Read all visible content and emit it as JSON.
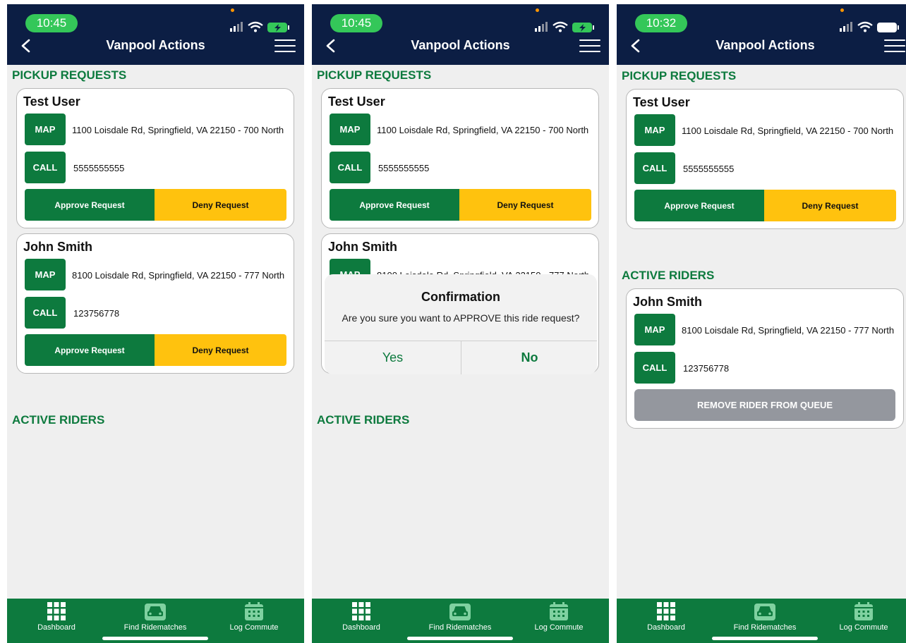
{
  "colors": {
    "navy": "#0c1e44",
    "green": "#0d7a3e",
    "yellow": "#ffc20e",
    "gray": "#94979e",
    "background": "#efefef"
  },
  "header": {
    "title": "Vanpool Actions"
  },
  "sections": {
    "pickup": "PICKUP REQUESTS",
    "active": "ACTIVE RIDERS"
  },
  "buttons": {
    "map": "MAP",
    "call": "CALL",
    "approve": "Approve Request",
    "deny": "Deny Request",
    "remove": "REMOVE RIDER FROM QUEUE"
  },
  "screens": [
    {
      "time": "10:45"
    },
    {
      "time": "10:45"
    },
    {
      "time": "10:32"
    }
  ],
  "riders": {
    "test_user": {
      "name": "Test User",
      "address": "1100 Loisdale Rd, Springfield, VA 22150 - 700 North",
      "phone": "5555555555"
    },
    "john_smith": {
      "name": "John Smith",
      "address": "8100 Loisdale Rd, Springfield, VA 22150 - 777 North",
      "phone": "123756778"
    }
  },
  "dialog": {
    "title": "Confirmation",
    "message": "Are you sure you want to APPROVE this ride request?",
    "yes": "Yes",
    "no": "No"
  },
  "tabs": [
    {
      "label": "Dashboard",
      "icon": "grid-icon"
    },
    {
      "label": "Find Ridematches",
      "icon": "car-icon"
    },
    {
      "label": "Log Commute",
      "icon": "calendar-icon"
    }
  ]
}
